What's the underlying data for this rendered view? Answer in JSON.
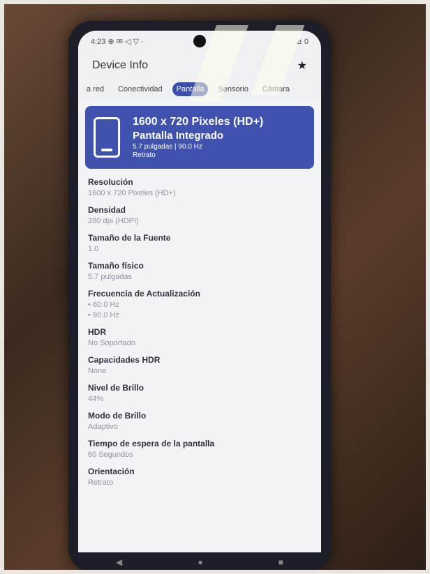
{
  "status": {
    "left": "4:23 ⊕ ✉ ◁ ▽ ·",
    "right": "⊿ 0"
  },
  "app": {
    "title": "Device Info",
    "star_icon": "star-icon"
  },
  "tabs": [
    {
      "label": "a red"
    },
    {
      "label": "Conectividad"
    },
    {
      "label": "Pantalla"
    },
    {
      "label": "Sensorio"
    },
    {
      "label": "Cámara"
    }
  ],
  "hero": {
    "resolution": "1600 x 720 Pixeles (HD+)",
    "type": "Pantalla Integrado",
    "specs": "5.7 pulgadas | 90.0 Hz",
    "orientation": "Retrato",
    "icon": "phone-screen-icon"
  },
  "items": [
    {
      "key": "Resolución",
      "value": "1600 x 720 Pixeles (HD+)"
    },
    {
      "key": "Densidad",
      "value": "280 dpi (HDPI)"
    },
    {
      "key": "Tamaño de la Fuente",
      "value": "1.0"
    },
    {
      "key": "Tamaño físico",
      "value": "5.7 pulgadas"
    },
    {
      "key": "Frecuencia de Actualización",
      "value": "• 60.0 Hz",
      "value2": "• 90.0 Hz"
    },
    {
      "key": "HDR",
      "value": "No Soportado"
    },
    {
      "key": "Capacidades HDR",
      "value": "None"
    },
    {
      "key": "Nivel de Brillo",
      "value": "44%"
    },
    {
      "key": "Modo de Brillo",
      "value": "Adaptivo"
    },
    {
      "key": "Tiempo de espera de la pantalla",
      "value": "60 Segundos"
    },
    {
      "key": "Orientación",
      "value": "Retrato"
    }
  ],
  "nav": {
    "back": "◀",
    "home": "●",
    "recents": "■"
  }
}
